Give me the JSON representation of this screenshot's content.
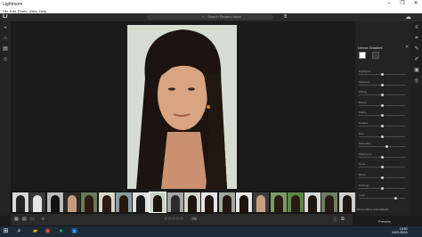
{
  "window": {
    "title": "Lightroom",
    "controls": [
      "–",
      "❐",
      "✕"
    ]
  },
  "menu": [
    "File",
    "Edit",
    "Photo",
    "View",
    "Help"
  ],
  "topbar": {
    "logo": "Lr",
    "search_placeholder": "Search Related Input"
  },
  "panel": {
    "title": "Linear Gradient",
    "sliders": [
      {
        "label": "Highlights",
        "value": 0.5
      },
      {
        "label": "Shadows",
        "value": 0.5
      },
      {
        "label": "Whites",
        "value": 0.5
      },
      {
        "label": "Blacks",
        "value": 0.5
      },
      {
        "label": "Clarity",
        "value": 0.5
      },
      {
        "label": "Dehaze",
        "value": 0.5
      },
      {
        "label": "Hue",
        "value": 0.5
      },
      {
        "label": "Saturation",
        "value": 0.6
      },
      {
        "label": "Sharpness",
        "value": 0.5
      },
      {
        "label": "Noise",
        "value": 0.5
      },
      {
        "label": "Moire",
        "value": 0.5
      },
      {
        "label": "Defringe",
        "value": 0.5
      },
      {
        "label": "Color",
        "value": 0.8
      }
    ],
    "reset_label": "Reset sliders automatically",
    "presets_label": "Presets"
  },
  "bottom": {
    "fit_label": "Fit"
  },
  "filmstrip": {
    "count": 20,
    "selected_index": 8
  },
  "taskbar": {
    "time": "16:50",
    "date": "24/01/2024"
  }
}
